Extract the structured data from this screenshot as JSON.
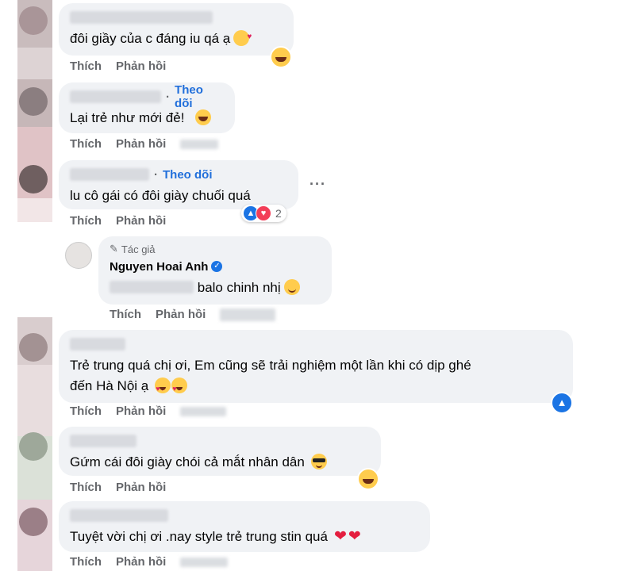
{
  "actions": {
    "like": "Thích",
    "reply": "Phản hồi"
  },
  "follow_label": "Theo dõi",
  "comments": [
    {
      "text": "đôi giầy của c đáng iu qá ạ"
    },
    {
      "text": "Lại trẻ như mới đẻ!"
    },
    {
      "text": "lu cô gái có đôi giày chuối quá",
      "name_visible": "Đỗ Minh Hà",
      "reaction_count": "2"
    },
    {
      "author_tag": "Tác giả",
      "name": "Nguyen Hoai Anh",
      "text": "balo chinh nhị"
    },
    {
      "text_line1": "Trẻ trung quá chị ơi, Em cũng sẽ trải nghiệm một lần khi có dịp ghé",
      "text_line2": "đến Hà Nội ạ"
    },
    {
      "text": "Gứm cái đôi giày chói cả mắt nhân dân"
    },
    {
      "text": "Tuyệt vời chị ơi .nay style trẻ trung stin quá"
    }
  ],
  "colors": {
    "link": "#216fdb",
    "bubble": "#f0f2f5",
    "meta": "#65676b"
  },
  "icons": [
    "laugh-emoji",
    "heart-eyes-emoji",
    "smile-emoji",
    "cool-emoji",
    "kiss-emoji",
    "like-reaction",
    "love-reaction",
    "verified-badge",
    "pen-icon",
    "more-icon"
  ]
}
